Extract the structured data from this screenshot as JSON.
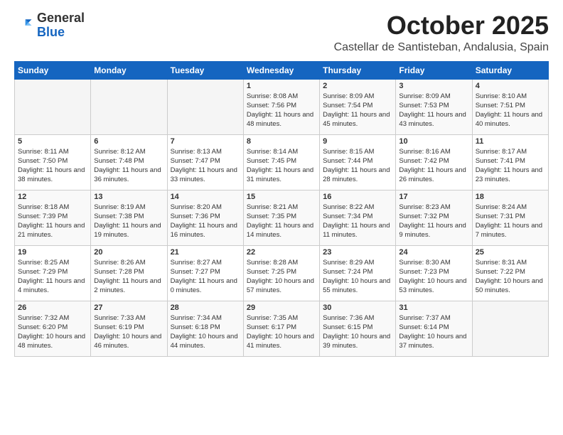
{
  "logo": {
    "general": "General",
    "blue": "Blue"
  },
  "header": {
    "month": "October 2025",
    "location": "Castellar de Santisteban, Andalusia, Spain"
  },
  "days_of_week": [
    "Sunday",
    "Monday",
    "Tuesday",
    "Wednesday",
    "Thursday",
    "Friday",
    "Saturday"
  ],
  "weeks": [
    [
      {
        "day": "",
        "info": ""
      },
      {
        "day": "",
        "info": ""
      },
      {
        "day": "",
        "info": ""
      },
      {
        "day": "1",
        "info": "Sunrise: 8:08 AM\nSunset: 7:56 PM\nDaylight: 11 hours and 48 minutes."
      },
      {
        "day": "2",
        "info": "Sunrise: 8:09 AM\nSunset: 7:54 PM\nDaylight: 11 hours and 45 minutes."
      },
      {
        "day": "3",
        "info": "Sunrise: 8:09 AM\nSunset: 7:53 PM\nDaylight: 11 hours and 43 minutes."
      },
      {
        "day": "4",
        "info": "Sunrise: 8:10 AM\nSunset: 7:51 PM\nDaylight: 11 hours and 40 minutes."
      }
    ],
    [
      {
        "day": "5",
        "info": "Sunrise: 8:11 AM\nSunset: 7:50 PM\nDaylight: 11 hours and 38 minutes."
      },
      {
        "day": "6",
        "info": "Sunrise: 8:12 AM\nSunset: 7:48 PM\nDaylight: 11 hours and 36 minutes."
      },
      {
        "day": "7",
        "info": "Sunrise: 8:13 AM\nSunset: 7:47 PM\nDaylight: 11 hours and 33 minutes."
      },
      {
        "day": "8",
        "info": "Sunrise: 8:14 AM\nSunset: 7:45 PM\nDaylight: 11 hours and 31 minutes."
      },
      {
        "day": "9",
        "info": "Sunrise: 8:15 AM\nSunset: 7:44 PM\nDaylight: 11 hours and 28 minutes."
      },
      {
        "day": "10",
        "info": "Sunrise: 8:16 AM\nSunset: 7:42 PM\nDaylight: 11 hours and 26 minutes."
      },
      {
        "day": "11",
        "info": "Sunrise: 8:17 AM\nSunset: 7:41 PM\nDaylight: 11 hours and 23 minutes."
      }
    ],
    [
      {
        "day": "12",
        "info": "Sunrise: 8:18 AM\nSunset: 7:39 PM\nDaylight: 11 hours and 21 minutes."
      },
      {
        "day": "13",
        "info": "Sunrise: 8:19 AM\nSunset: 7:38 PM\nDaylight: 11 hours and 19 minutes."
      },
      {
        "day": "14",
        "info": "Sunrise: 8:20 AM\nSunset: 7:36 PM\nDaylight: 11 hours and 16 minutes."
      },
      {
        "day": "15",
        "info": "Sunrise: 8:21 AM\nSunset: 7:35 PM\nDaylight: 11 hours and 14 minutes."
      },
      {
        "day": "16",
        "info": "Sunrise: 8:22 AM\nSunset: 7:34 PM\nDaylight: 11 hours and 11 minutes."
      },
      {
        "day": "17",
        "info": "Sunrise: 8:23 AM\nSunset: 7:32 PM\nDaylight: 11 hours and 9 minutes."
      },
      {
        "day": "18",
        "info": "Sunrise: 8:24 AM\nSunset: 7:31 PM\nDaylight: 11 hours and 7 minutes."
      }
    ],
    [
      {
        "day": "19",
        "info": "Sunrise: 8:25 AM\nSunset: 7:29 PM\nDaylight: 11 hours and 4 minutes."
      },
      {
        "day": "20",
        "info": "Sunrise: 8:26 AM\nSunset: 7:28 PM\nDaylight: 11 hours and 2 minutes."
      },
      {
        "day": "21",
        "info": "Sunrise: 8:27 AM\nSunset: 7:27 PM\nDaylight: 11 hours and 0 minutes."
      },
      {
        "day": "22",
        "info": "Sunrise: 8:28 AM\nSunset: 7:25 PM\nDaylight: 10 hours and 57 minutes."
      },
      {
        "day": "23",
        "info": "Sunrise: 8:29 AM\nSunset: 7:24 PM\nDaylight: 10 hours and 55 minutes."
      },
      {
        "day": "24",
        "info": "Sunrise: 8:30 AM\nSunset: 7:23 PM\nDaylight: 10 hours and 53 minutes."
      },
      {
        "day": "25",
        "info": "Sunrise: 8:31 AM\nSunset: 7:22 PM\nDaylight: 10 hours and 50 minutes."
      }
    ],
    [
      {
        "day": "26",
        "info": "Sunrise: 7:32 AM\nSunset: 6:20 PM\nDaylight: 10 hours and 48 minutes."
      },
      {
        "day": "27",
        "info": "Sunrise: 7:33 AM\nSunset: 6:19 PM\nDaylight: 10 hours and 46 minutes."
      },
      {
        "day": "28",
        "info": "Sunrise: 7:34 AM\nSunset: 6:18 PM\nDaylight: 10 hours and 44 minutes."
      },
      {
        "day": "29",
        "info": "Sunrise: 7:35 AM\nSunset: 6:17 PM\nDaylight: 10 hours and 41 minutes."
      },
      {
        "day": "30",
        "info": "Sunrise: 7:36 AM\nSunset: 6:15 PM\nDaylight: 10 hours and 39 minutes."
      },
      {
        "day": "31",
        "info": "Sunrise: 7:37 AM\nSunset: 6:14 PM\nDaylight: 10 hours and 37 minutes."
      },
      {
        "day": "",
        "info": ""
      }
    ]
  ]
}
